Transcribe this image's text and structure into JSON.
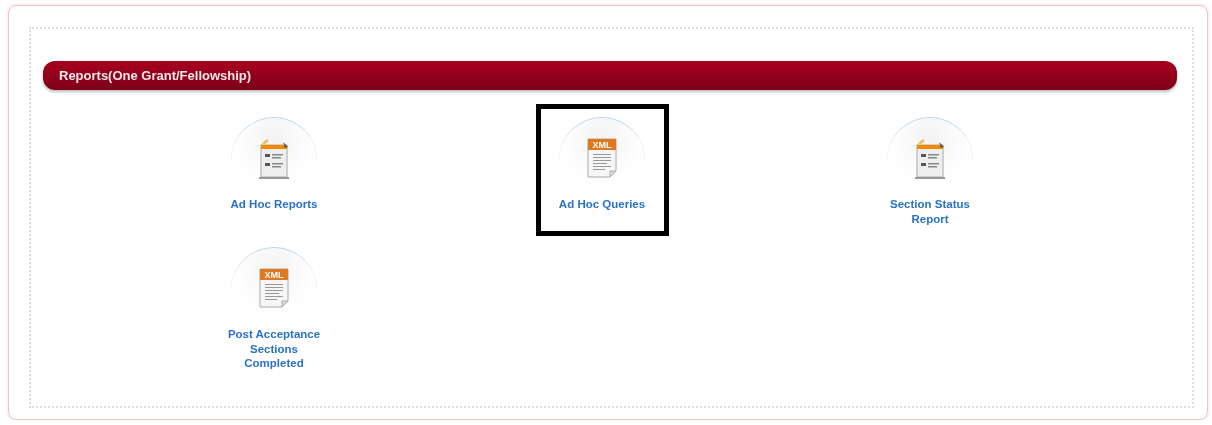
{
  "panel": {
    "title": "Reports(One Grant/Fellowship)"
  },
  "items": [
    {
      "kind": "report",
      "label": "Ad Hoc Reports",
      "highlighted": false
    },
    {
      "kind": "xml",
      "badge": "XML",
      "label": "Ad Hoc Queries",
      "highlighted": true
    },
    {
      "kind": "report",
      "label": "Section Status Report",
      "highlighted": false
    },
    {
      "kind": "xml",
      "badge": "XML",
      "label": "Post Acceptance Sections Completed",
      "highlighted": false
    }
  ]
}
